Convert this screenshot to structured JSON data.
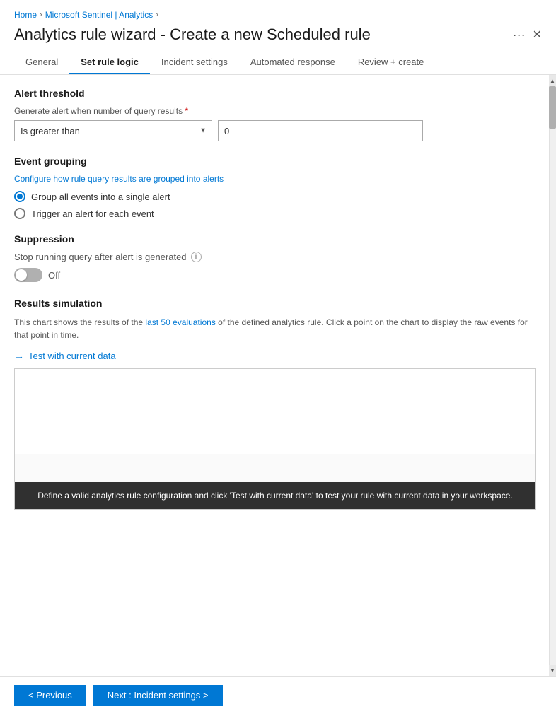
{
  "breadcrumb": {
    "home_label": "Home",
    "sentinel_label": "Microsoft Sentinel | Analytics"
  },
  "page": {
    "title": "Analytics rule wizard - Create a new Scheduled rule",
    "menu_icon": "···",
    "close_icon": "✕"
  },
  "tabs": [
    {
      "id": "general",
      "label": "General",
      "active": false
    },
    {
      "id": "set-rule-logic",
      "label": "Set rule logic",
      "active": true
    },
    {
      "id": "incident-settings",
      "label": "Incident settings",
      "active": false
    },
    {
      "id": "automated-response",
      "label": "Automated response",
      "active": false
    },
    {
      "id": "review-create",
      "label": "Review + create",
      "active": false
    }
  ],
  "alert_threshold": {
    "section_title": "Alert threshold",
    "field_label": "Generate alert when number of query results",
    "required_indicator": "*",
    "select_options": [
      {
        "value": "is_greater_than",
        "label": "Is greater than"
      }
    ],
    "select_value": "Is greater than",
    "number_value": "0"
  },
  "event_grouping": {
    "section_title": "Event grouping",
    "subtitle": "Configure how rule query results are grouped into alerts",
    "options": [
      {
        "id": "group_single",
        "label": "Group all events into a single alert",
        "checked": true
      },
      {
        "id": "trigger_each",
        "label": "Trigger an alert for each event",
        "checked": false
      }
    ]
  },
  "suppression": {
    "section_title": "Suppression",
    "stop_label": "Stop running query after alert is generated",
    "toggle_state": "Off"
  },
  "results_simulation": {
    "section_title": "Results simulation",
    "description_parts": [
      "This chart shows the results of the ",
      "last 50 evaluations",
      " of the defined analytics rule. Click a point on the chart to display the raw events for that point in time."
    ],
    "test_link_label": "Test with current data",
    "chart_message": "Define a valid analytics rule configuration and click 'Test with current data' to test your rule with current data in your workspace."
  },
  "footer": {
    "prev_label": "< Previous",
    "next_label": "Next : Incident settings >"
  },
  "scrollbar": {
    "up_arrow": "▲",
    "down_arrow": "▼"
  }
}
